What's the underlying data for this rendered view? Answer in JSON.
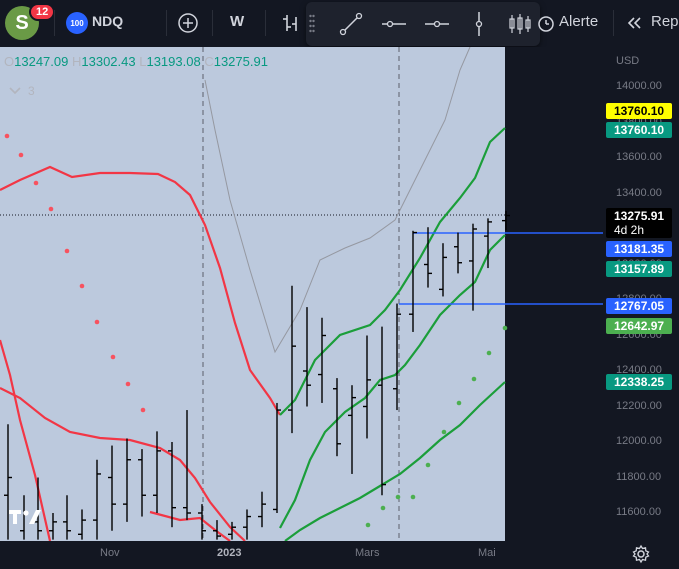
{
  "header": {
    "avatar_letter": "S",
    "notification_count": "12",
    "symbol_logo_text": "100",
    "symbol": "NDQ",
    "interval": "W",
    "alert_label": "Alerte",
    "replay_label": "Rep",
    "icons": [
      "plus-circle-icon",
      "bar-style-icon",
      "trend-line-icon",
      "horizontal-line-icon",
      "horizontal-ray-icon",
      "vertical-line-icon",
      "candles-icon",
      "alarm-clock-icon",
      "replay-icon"
    ]
  },
  "legend": {
    "open_key": "O",
    "open": "13247.09",
    "high_key": "H",
    "high": "13302.43",
    "low_key": "L",
    "low": "13193.08",
    "close_key": "C",
    "close": "13275.91",
    "indicators_count": "3"
  },
  "price_scale": {
    "currency": "USD",
    "ticks": [
      "14000.00",
      "13800.00",
      "13600.00",
      "13400.00",
      "13200.00",
      "13000.00",
      "12800.00",
      "12600.00",
      "12400.00",
      "12200.00",
      "12000.00",
      "11800.00",
      "11600.00"
    ],
    "labels": [
      {
        "value": "13760.10",
        "bg": "#ffff00",
        "fg": "#000000"
      },
      {
        "value": "13760.10",
        "bg": "#089981",
        "fg": "#ffffff"
      },
      {
        "value": "13275.91",
        "bg": "#000000",
        "fg": "#ffffff"
      },
      {
        "value": "4d 2h",
        "bg": "#000000",
        "fg": "#ffffff"
      },
      {
        "value": "13181.35",
        "bg": "#2962ff",
        "fg": "#ffffff"
      },
      {
        "value": "13157.89",
        "bg": "#089981",
        "fg": "#ffffff"
      },
      {
        "value": "12767.05",
        "bg": "#2962ff",
        "fg": "#ffffff"
      },
      {
        "value": "12642.97",
        "bg": "#4caf50",
        "fg": "#ffffff"
      },
      {
        "value": "12338.25",
        "bg": "#089981",
        "fg": "#ffffff"
      }
    ]
  },
  "time_scale": {
    "labels": [
      "Nov",
      "2023",
      "Mars",
      "Mai"
    ]
  },
  "colors": {
    "background": "#131722",
    "cloud_fill": "#c5d3e8",
    "red_band": "#f23645",
    "green_band": "#1b9e3a",
    "bars": "#000000",
    "gray_line": "#9598a1",
    "psar": "#f7525f",
    "psar_up": "#4caf50",
    "hline": "#2962ff"
  },
  "chart_data": {
    "type": "bar",
    "ylim": [
      11450,
      14200
    ],
    "grid": false,
    "hlines": [
      13181.35,
      12767.05
    ],
    "last_price": 13275.91,
    "bars": [
      {
        "x": 8,
        "o": 11700,
        "h": 12100,
        "l": 11450,
        "c": 11800
      },
      {
        "x": 24,
        "o": 11500,
        "h": 11700,
        "l": 11450,
        "c": 11600
      },
      {
        "x": 38,
        "o": 11550,
        "h": 11800,
        "l": 11450,
        "c": 11500
      },
      {
        "x": 53,
        "o": 11500,
        "h": 11600,
        "l": 11450,
        "c": 11550
      },
      {
        "x": 67,
        "o": 11550,
        "h": 11700,
        "l": 11450,
        "c": 11500
      },
      {
        "x": 82,
        "o": 11480,
        "h": 11620,
        "l": 11450,
        "c": 11560
      },
      {
        "x": 97,
        "o": 11560,
        "h": 11900,
        "l": 11450,
        "c": 11820
      },
      {
        "x": 112,
        "o": 11800,
        "h": 11980,
        "l": 11500,
        "c": 11650
      },
      {
        "x": 127,
        "o": 11650,
        "h": 12020,
        "l": 11550,
        "c": 11900
      },
      {
        "x": 142,
        "o": 11900,
        "h": 11960,
        "l": 11580,
        "c": 11700
      },
      {
        "x": 157,
        "o": 11700,
        "h": 12060,
        "l": 11600,
        "c": 11950
      },
      {
        "x": 172,
        "o": 11950,
        "h": 12000,
        "l": 11520,
        "c": 11630
      },
      {
        "x": 187,
        "o": 11630,
        "h": 12180,
        "l": 11560,
        "c": 11600
      },
      {
        "x": 202,
        "o": 11600,
        "h": 11650,
        "l": 11450,
        "c": 11500
      },
      {
        "x": 217,
        "o": 11500,
        "h": 11560,
        "l": 11450,
        "c": 11470
      },
      {
        "x": 232,
        "o": 11480,
        "h": 11550,
        "l": 11450,
        "c": 11520
      },
      {
        "x": 247,
        "o": 11520,
        "h": 11620,
        "l": 11450,
        "c": 11580
      },
      {
        "x": 262,
        "o": 11580,
        "h": 11720,
        "l": 11520,
        "c": 11650
      },
      {
        "x": 277,
        "o": 11620,
        "h": 12220,
        "l": 11600,
        "c": 12180
      },
      {
        "x": 292,
        "o": 12180,
        "h": 12880,
        "l": 12050,
        "c": 12540
      },
      {
        "x": 307,
        "o": 12400,
        "h": 12760,
        "l": 12200,
        "c": 12320
      },
      {
        "x": 322,
        "o": 12380,
        "h": 12700,
        "l": 12220,
        "c": 12600
      },
      {
        "x": 337,
        "o": 12300,
        "h": 12360,
        "l": 11920,
        "c": 11990
      },
      {
        "x": 352,
        "o": 12150,
        "h": 12320,
        "l": 11820,
        "c": 12250
      },
      {
        "x": 367,
        "o": 12200,
        "h": 12600,
        "l": 12020,
        "c": 12350
      },
      {
        "x": 382,
        "o": 12320,
        "h": 12650,
        "l": 11700,
        "c": 11760
      },
      {
        "x": 397,
        "o": 12300,
        "h": 12780,
        "l": 12180,
        "c": 12720
      },
      {
        "x": 413,
        "o": 12720,
        "h": 13190,
        "l": 12620,
        "c": 13180
      },
      {
        "x": 428,
        "o": 13000,
        "h": 13210,
        "l": 12870,
        "c": 12950
      },
      {
        "x": 443,
        "o": 12860,
        "h": 13120,
        "l": 12820,
        "c": 13040
      },
      {
        "x": 458,
        "o": 13100,
        "h": 13180,
        "l": 12950,
        "c": 13010
      },
      {
        "x": 473,
        "o": 13020,
        "h": 13230,
        "l": 12740,
        "c": 13200
      },
      {
        "x": 488,
        "o": 13160,
        "h": 13260,
        "l": 12980,
        "c": 13240
      },
      {
        "x": 506,
        "o": 13247.09,
        "h": 13302.43,
        "l": 13193.08,
        "c": 13275.91
      }
    ]
  }
}
